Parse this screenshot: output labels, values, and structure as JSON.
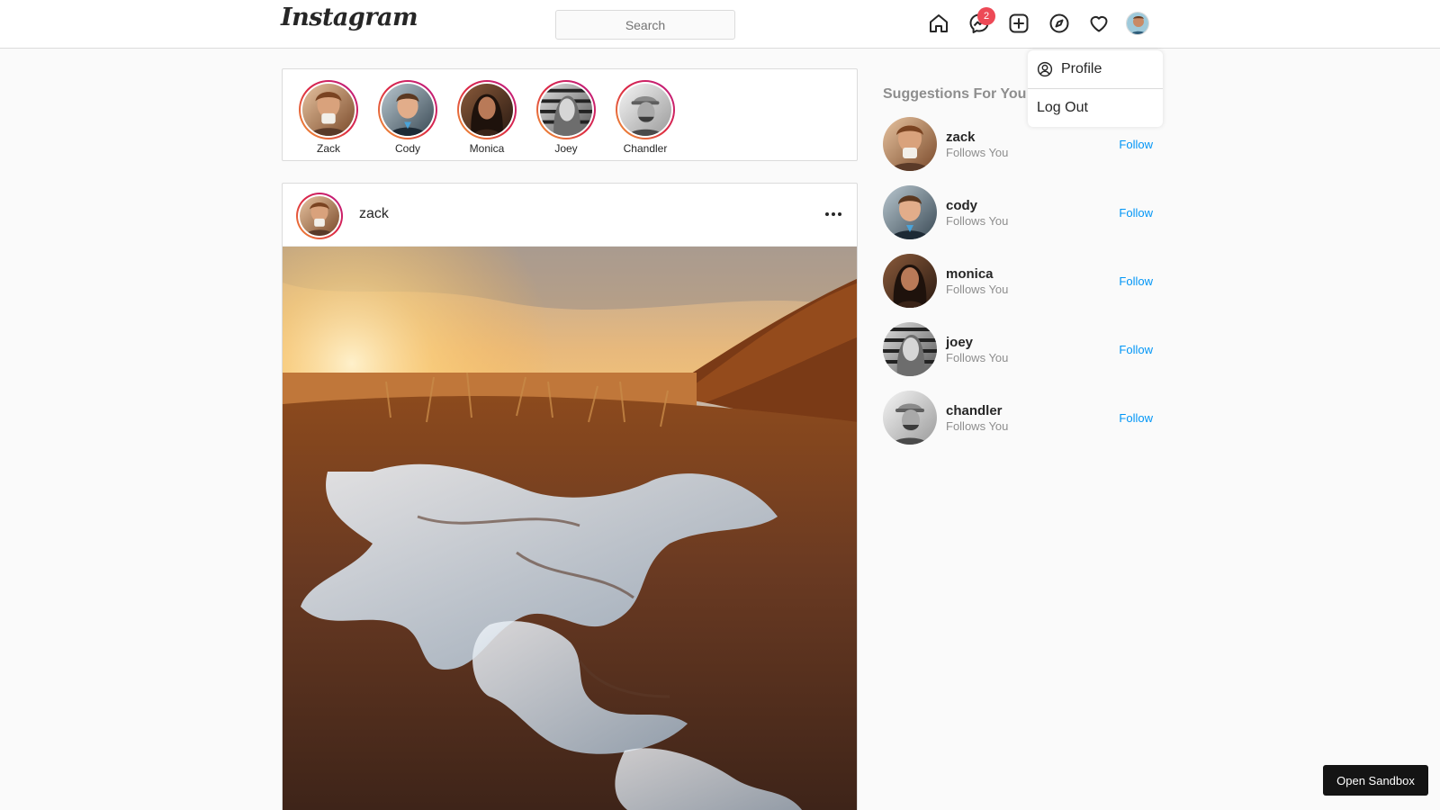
{
  "header": {
    "logo_text": "Instagram",
    "search_placeholder": "Search",
    "messages_badge": "2",
    "icons": [
      "home-icon",
      "messenger-icon",
      "new-post-icon",
      "explore-icon",
      "activity-heart-icon"
    ]
  },
  "dropdown": {
    "items": [
      {
        "label": "Profile",
        "icon": "user-circle-icon"
      },
      {
        "label": "Log Out"
      }
    ]
  },
  "stories": [
    {
      "name": "Zack"
    },
    {
      "name": "Cody"
    },
    {
      "name": "Monica"
    },
    {
      "name": "Joey"
    },
    {
      "name": "Chandler"
    }
  ],
  "post": {
    "username": "zack",
    "image_description_icon": "landscape-photo"
  },
  "suggestions": {
    "title": "Suggestions For You",
    "items": [
      {
        "name": "zack",
        "subtitle": "Follows You",
        "action": "Follow"
      },
      {
        "name": "cody",
        "subtitle": "Follows You",
        "action": "Follow"
      },
      {
        "name": "monica",
        "subtitle": "Follows You",
        "action": "Follow"
      },
      {
        "name": "joey",
        "subtitle": "Follows You",
        "action": "Follow"
      },
      {
        "name": "chandler",
        "subtitle": "Follows You",
        "action": "Follow"
      }
    ]
  },
  "sandbox_button": "Open Sandbox",
  "colors": {
    "accent": "#0095f6",
    "badge": "#ed4956",
    "border": "#dbdbdb"
  }
}
